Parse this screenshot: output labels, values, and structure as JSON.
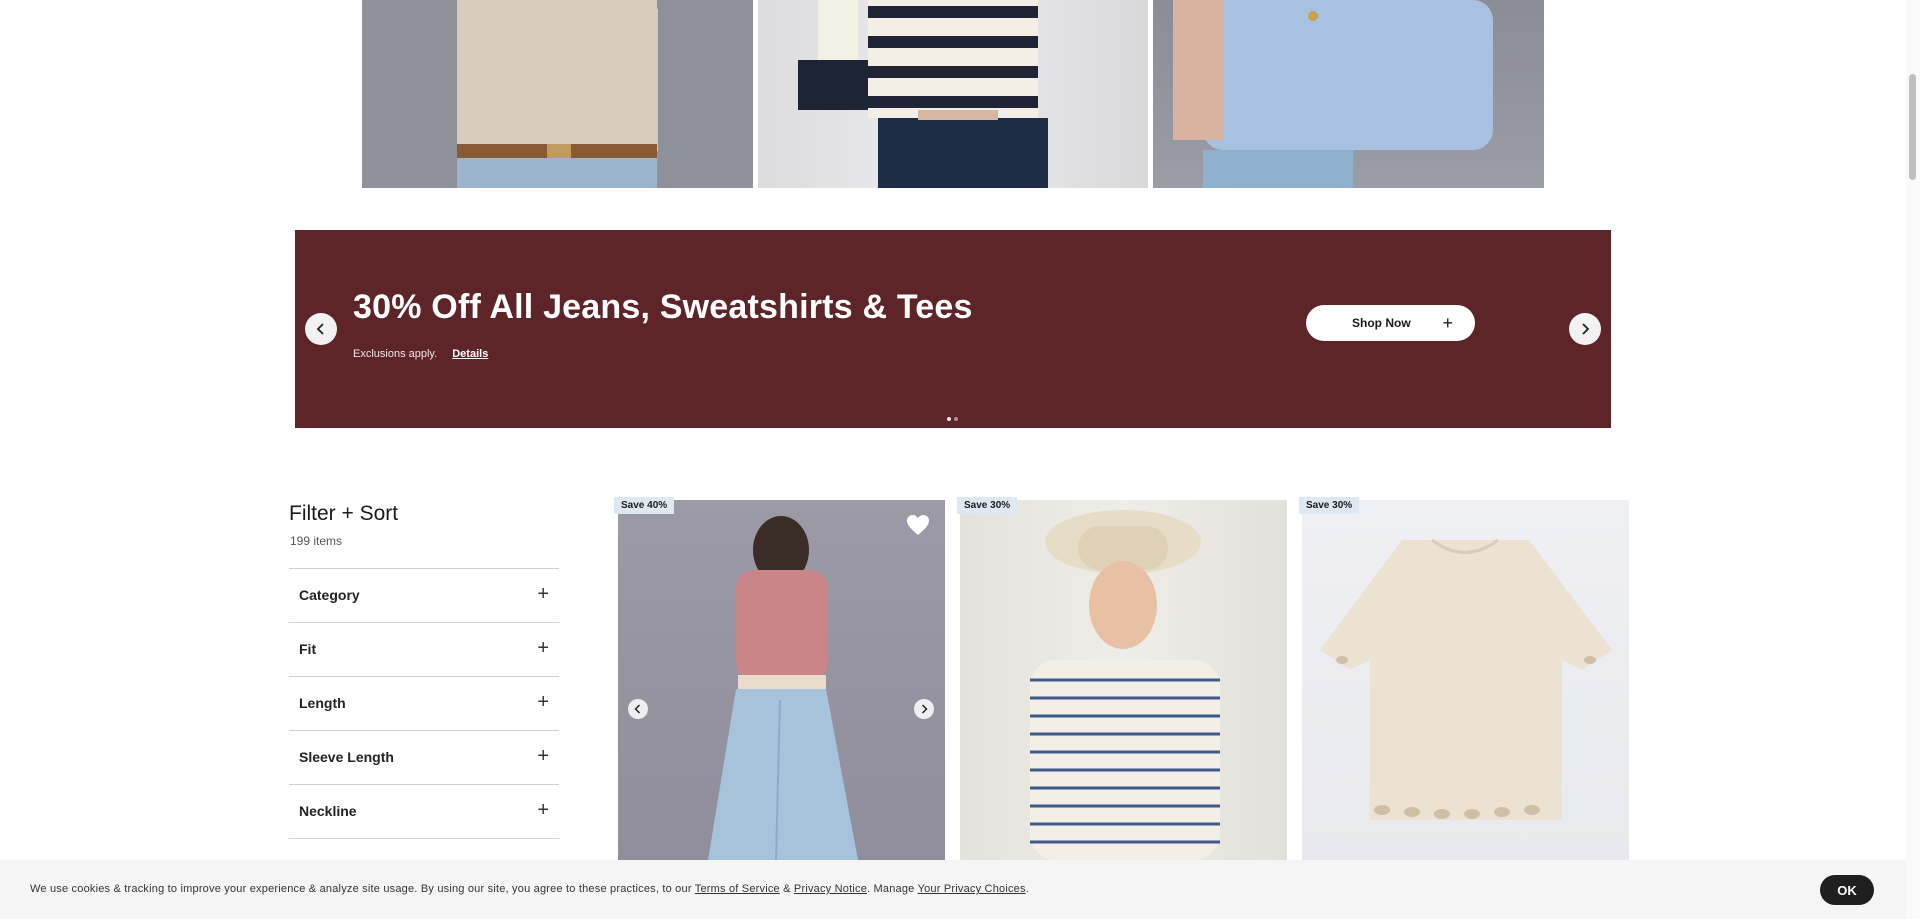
{
  "hero": {
    "images": [
      {
        "alt": "Model in beige tee with belt"
      },
      {
        "alt": "Model in navy striped tee"
      },
      {
        "alt": "Model in light blue tee"
      }
    ]
  },
  "promo": {
    "title": "30% Off All Jeans, Sweatshirts & Tees",
    "subtitle": "Exclusions apply.",
    "details_link": "Details",
    "cta": "Shop Now",
    "background_color": "#5e2529"
  },
  "filter": {
    "title": "Filter + Sort",
    "count": "199 items",
    "sections": [
      {
        "label": "Category"
      },
      {
        "label": "Fit"
      },
      {
        "label": "Length"
      },
      {
        "label": "Sleeve Length"
      },
      {
        "label": "Neckline"
      }
    ]
  },
  "products": [
    {
      "badge": "Save 40%"
    },
    {
      "badge": "Save 30%"
    },
    {
      "badge": "Save 30%"
    }
  ],
  "cookie": {
    "text_before": "We use cookies & tracking to improve your experience & analyze site usage. By using our site, you agree to these practices, to our ",
    "terms_link": "Terms of Service",
    "amp": " & ",
    "privacy_link": "Privacy Notice",
    "manage": ". Manage ",
    "choices_link": "Your Privacy Choices",
    "end": ".",
    "ok": "OK"
  }
}
